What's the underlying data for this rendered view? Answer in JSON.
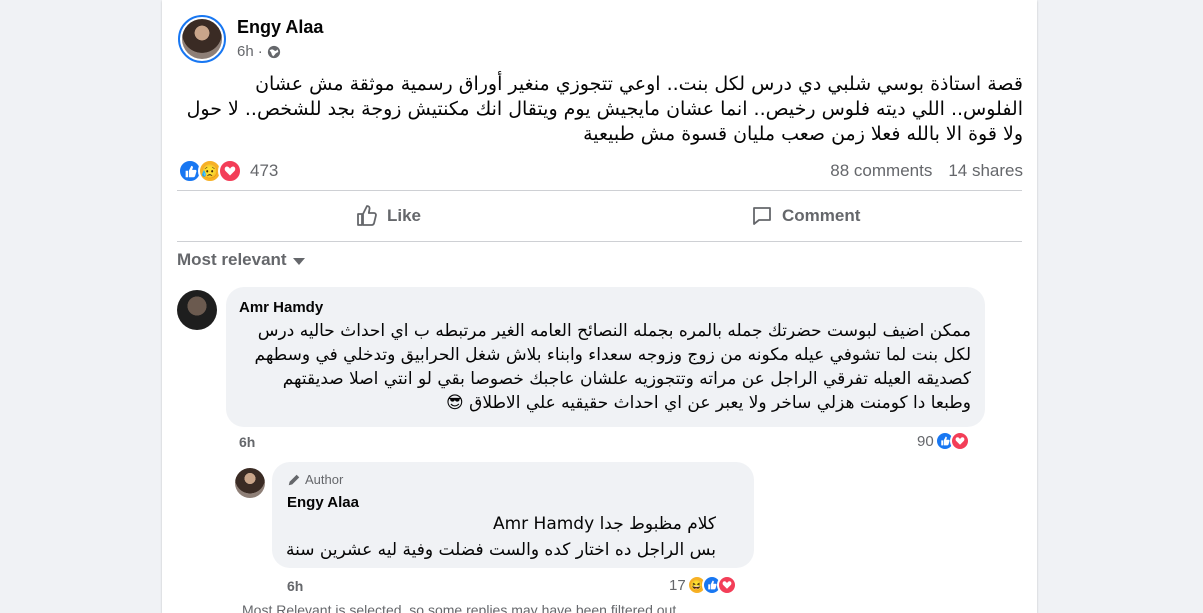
{
  "post": {
    "author": "Engy Alaa",
    "time": "6h",
    "separator": "·",
    "audience_icon": "globe-icon",
    "text": "قصة استاذة بوسي شلبي دي درس لكل بنت.. اوعي تتجوزي منغير أوراق رسمية موثقة مش عشان الفلوس.. اللي ديته فلوس رخيص.. انما عشان مايجيش يوم ويتقال انك مكنتيش زوجة بجد للشخص.. لا حول ولا قوة الا بالله فعلا زمن صعب مليان قسوة مش طبيعية",
    "reaction_icons": [
      "like-icon",
      "sad-icon",
      "love-icon"
    ],
    "reaction_count": "473",
    "comments_count": "88 comments",
    "shares_count": "14 shares"
  },
  "actions": {
    "like_label": "Like",
    "comment_label": "Comment"
  },
  "sort": {
    "label": "Most relevant"
  },
  "comments": [
    {
      "author": "Amr Hamdy",
      "text": "ممكن اضيف لبوست حضرتك جمله بالمره بجمله النصائح العامه الغير مرتبطه ب اي احداث حاليه درس لكل بنت لما تشوفي عيله مكونه من زوج وزوجه سعداء وابناء بلاش شغل الحرابيق وتدخلي في وسطهم كصديقه العيله تفرقي الراجل عن مراته وتتجوزيه علشان عاجبك خصوصا بقي لو انتي اصلا صديقتهم وطبعا دا كومنت هزلي ساخر ولا يعبر عن اي احداث حقيقيه علي الاطلاق 😎",
      "time": "6h",
      "reaction_count": "90"
    },
    {
      "badge": "Author",
      "author": "Engy Alaa",
      "mention": "Amr Hamdy",
      "text_line1": "كلام مظبوط جدا",
      "text_line2": "بس الراجل ده اختار كده والست فضلت وفية ليه عشرين سنة",
      "time": "6h",
      "reaction_count": "17"
    }
  ],
  "footer_partial": "Most Relevant is selected, so some replies may have been filtered out."
}
